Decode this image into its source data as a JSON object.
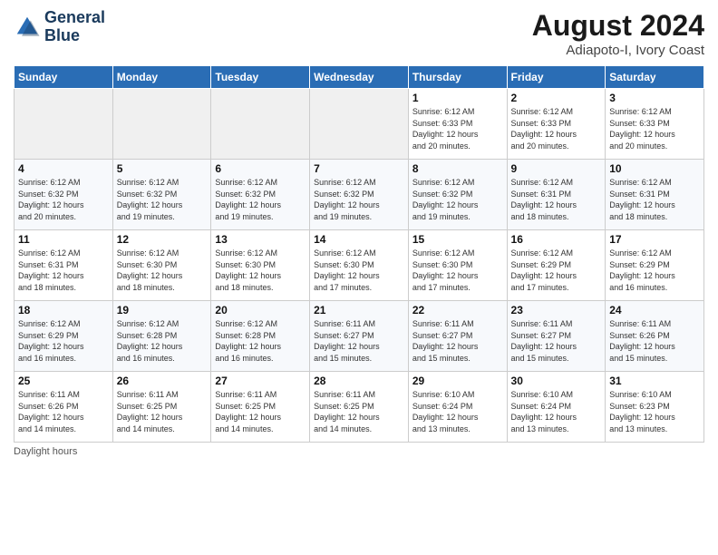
{
  "logo": {
    "line1": "General",
    "line2": "Blue"
  },
  "title": "August 2024",
  "location": "Adiapoto-I, Ivory Coast",
  "days_of_week": [
    "Sunday",
    "Monday",
    "Tuesday",
    "Wednesday",
    "Thursday",
    "Friday",
    "Saturday"
  ],
  "footer": "Daylight hours",
  "weeks": [
    [
      {
        "day": "",
        "info": ""
      },
      {
        "day": "",
        "info": ""
      },
      {
        "day": "",
        "info": ""
      },
      {
        "day": "",
        "info": ""
      },
      {
        "day": "1",
        "info": "Sunrise: 6:12 AM\nSunset: 6:33 PM\nDaylight: 12 hours\nand 20 minutes."
      },
      {
        "day": "2",
        "info": "Sunrise: 6:12 AM\nSunset: 6:33 PM\nDaylight: 12 hours\nand 20 minutes."
      },
      {
        "day": "3",
        "info": "Sunrise: 6:12 AM\nSunset: 6:33 PM\nDaylight: 12 hours\nand 20 minutes."
      }
    ],
    [
      {
        "day": "4",
        "info": "Sunrise: 6:12 AM\nSunset: 6:32 PM\nDaylight: 12 hours\nand 20 minutes."
      },
      {
        "day": "5",
        "info": "Sunrise: 6:12 AM\nSunset: 6:32 PM\nDaylight: 12 hours\nand 19 minutes."
      },
      {
        "day": "6",
        "info": "Sunrise: 6:12 AM\nSunset: 6:32 PM\nDaylight: 12 hours\nand 19 minutes."
      },
      {
        "day": "7",
        "info": "Sunrise: 6:12 AM\nSunset: 6:32 PM\nDaylight: 12 hours\nand 19 minutes."
      },
      {
        "day": "8",
        "info": "Sunrise: 6:12 AM\nSunset: 6:32 PM\nDaylight: 12 hours\nand 19 minutes."
      },
      {
        "day": "9",
        "info": "Sunrise: 6:12 AM\nSunset: 6:31 PM\nDaylight: 12 hours\nand 18 minutes."
      },
      {
        "day": "10",
        "info": "Sunrise: 6:12 AM\nSunset: 6:31 PM\nDaylight: 12 hours\nand 18 minutes."
      }
    ],
    [
      {
        "day": "11",
        "info": "Sunrise: 6:12 AM\nSunset: 6:31 PM\nDaylight: 12 hours\nand 18 minutes."
      },
      {
        "day": "12",
        "info": "Sunrise: 6:12 AM\nSunset: 6:30 PM\nDaylight: 12 hours\nand 18 minutes."
      },
      {
        "day": "13",
        "info": "Sunrise: 6:12 AM\nSunset: 6:30 PM\nDaylight: 12 hours\nand 18 minutes."
      },
      {
        "day": "14",
        "info": "Sunrise: 6:12 AM\nSunset: 6:30 PM\nDaylight: 12 hours\nand 17 minutes."
      },
      {
        "day": "15",
        "info": "Sunrise: 6:12 AM\nSunset: 6:30 PM\nDaylight: 12 hours\nand 17 minutes."
      },
      {
        "day": "16",
        "info": "Sunrise: 6:12 AM\nSunset: 6:29 PM\nDaylight: 12 hours\nand 17 minutes."
      },
      {
        "day": "17",
        "info": "Sunrise: 6:12 AM\nSunset: 6:29 PM\nDaylight: 12 hours\nand 16 minutes."
      }
    ],
    [
      {
        "day": "18",
        "info": "Sunrise: 6:12 AM\nSunset: 6:29 PM\nDaylight: 12 hours\nand 16 minutes."
      },
      {
        "day": "19",
        "info": "Sunrise: 6:12 AM\nSunset: 6:28 PM\nDaylight: 12 hours\nand 16 minutes."
      },
      {
        "day": "20",
        "info": "Sunrise: 6:12 AM\nSunset: 6:28 PM\nDaylight: 12 hours\nand 16 minutes."
      },
      {
        "day": "21",
        "info": "Sunrise: 6:11 AM\nSunset: 6:27 PM\nDaylight: 12 hours\nand 15 minutes."
      },
      {
        "day": "22",
        "info": "Sunrise: 6:11 AM\nSunset: 6:27 PM\nDaylight: 12 hours\nand 15 minutes."
      },
      {
        "day": "23",
        "info": "Sunrise: 6:11 AM\nSunset: 6:27 PM\nDaylight: 12 hours\nand 15 minutes."
      },
      {
        "day": "24",
        "info": "Sunrise: 6:11 AM\nSunset: 6:26 PM\nDaylight: 12 hours\nand 15 minutes."
      }
    ],
    [
      {
        "day": "25",
        "info": "Sunrise: 6:11 AM\nSunset: 6:26 PM\nDaylight: 12 hours\nand 14 minutes."
      },
      {
        "day": "26",
        "info": "Sunrise: 6:11 AM\nSunset: 6:25 PM\nDaylight: 12 hours\nand 14 minutes."
      },
      {
        "day": "27",
        "info": "Sunrise: 6:11 AM\nSunset: 6:25 PM\nDaylight: 12 hours\nand 14 minutes."
      },
      {
        "day": "28",
        "info": "Sunrise: 6:11 AM\nSunset: 6:25 PM\nDaylight: 12 hours\nand 14 minutes."
      },
      {
        "day": "29",
        "info": "Sunrise: 6:10 AM\nSunset: 6:24 PM\nDaylight: 12 hours\nand 13 minutes."
      },
      {
        "day": "30",
        "info": "Sunrise: 6:10 AM\nSunset: 6:24 PM\nDaylight: 12 hours\nand 13 minutes."
      },
      {
        "day": "31",
        "info": "Sunrise: 6:10 AM\nSunset: 6:23 PM\nDaylight: 12 hours\nand 13 minutes."
      }
    ]
  ]
}
